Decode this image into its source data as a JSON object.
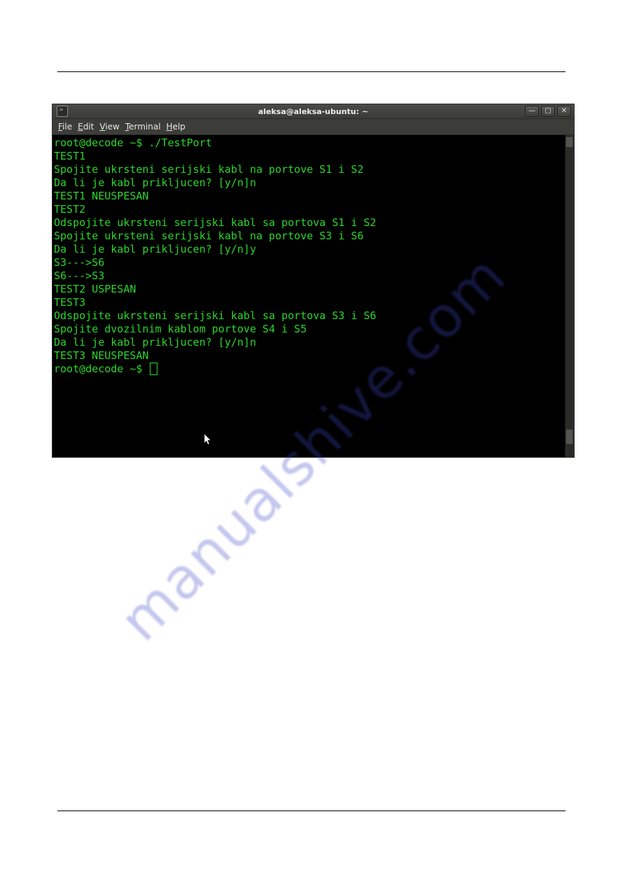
{
  "watermark_text": "manualshive.com",
  "window": {
    "title": "aleksa@aleksa-ubuntu: ~"
  },
  "menubar": {
    "items": [
      {
        "accel": "F",
        "rest": "ile"
      },
      {
        "accel": "E",
        "rest": "dit"
      },
      {
        "accel": "V",
        "rest": "iew"
      },
      {
        "accel": "T",
        "rest": "erminal"
      },
      {
        "accel": "H",
        "rest": "elp"
      }
    ]
  },
  "win_buttons": {
    "minimize": "—",
    "maximize": "▢",
    "close": "✕"
  },
  "terminal": {
    "prompt1": "root@decode ~$ ",
    "command1": "./TestPort",
    "lines": [
      "",
      "TEST1",
      "Spojite ukrsteni serijski kabl na portove S1 i S2",
      "Da li je kabl prikljucen? [y/n]n",
      "TEST1 NEUSPESAN",
      "",
      "TEST2",
      "Odspojite ukrsteni serijski kabl sa portova S1 i S2",
      "Spojite ukrsteni serijski kabl na portove S3 i S6",
      "Da li je kabl prikljucen? [y/n]y",
      "S3--->S6",
      "",
      "S6--->S3",
      "",
      "TEST2 USPESAN",
      "",
      "TEST3",
      "Odspojite ukrsteni serijski kabl sa portova S3 i S6",
      "Spojite dvozilnim kablom portove S4 i S5",
      "Da li je kabl prikljucen? [y/n]n",
      "TEST3 NEUSPESAN",
      ""
    ],
    "prompt2": "root@decode ~$ "
  }
}
